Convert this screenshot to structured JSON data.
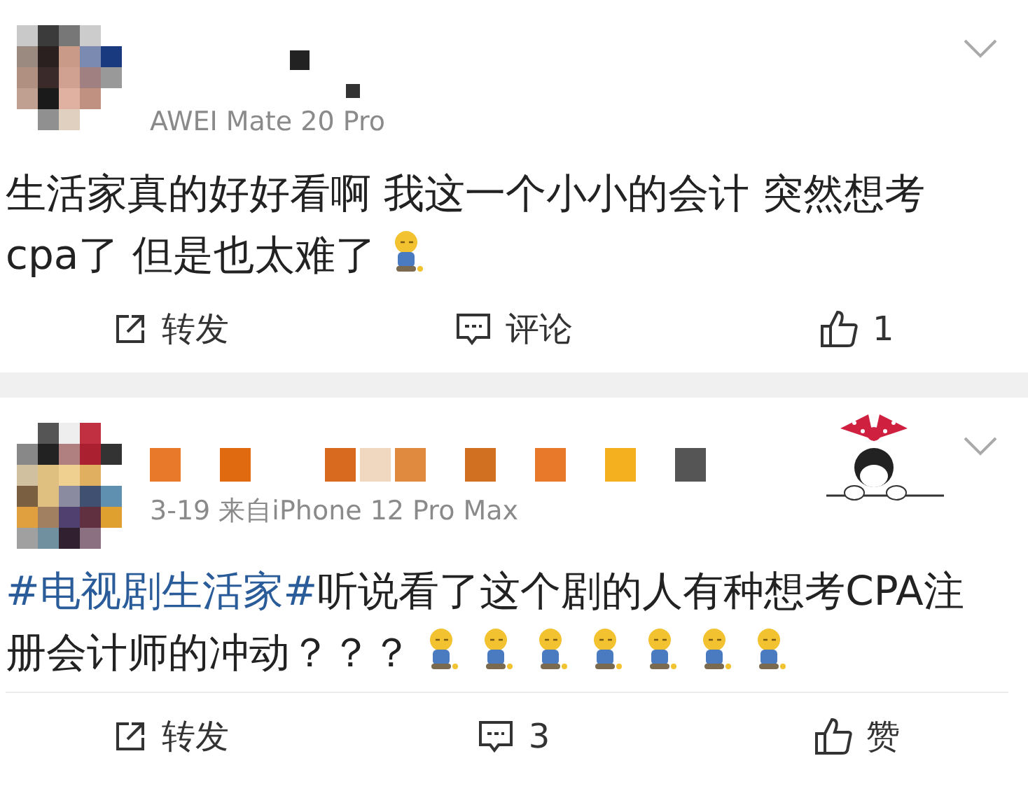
{
  "posts": [
    {
      "meta": "AWEI Mate 20 Pro",
      "has_sticker": false,
      "body": [
        {
          "kind": "text",
          "text": "生活家真的好好看啊 我这一个小小的会计 突然想考cpa了 但是也太难了 "
        },
        {
          "kind": "emoji"
        }
      ],
      "actions": [
        {
          "kind": "repost",
          "label": "转发"
        },
        {
          "kind": "comment",
          "label": "评论"
        },
        {
          "kind": "like",
          "label": "1"
        }
      ]
    },
    {
      "meta": "3-19 来自iPhone 12 Pro Max",
      "has_sticker": true,
      "body": [
        {
          "kind": "hashtag",
          "text": "#电视剧生活家#"
        },
        {
          "kind": "text",
          "text": "听说看了这个剧的人有种想考CPA注册会计师的冲动？？？ "
        },
        {
          "kind": "emoji"
        },
        {
          "kind": "emoji"
        },
        {
          "kind": "emoji"
        },
        {
          "kind": "emoji"
        },
        {
          "kind": "emoji"
        },
        {
          "kind": "emoji"
        },
        {
          "kind": "emoji"
        }
      ],
      "actions": [
        {
          "kind": "repost",
          "label": "转发"
        },
        {
          "kind": "comment",
          "label": "3"
        },
        {
          "kind": "like",
          "label": "赞"
        }
      ]
    }
  ]
}
